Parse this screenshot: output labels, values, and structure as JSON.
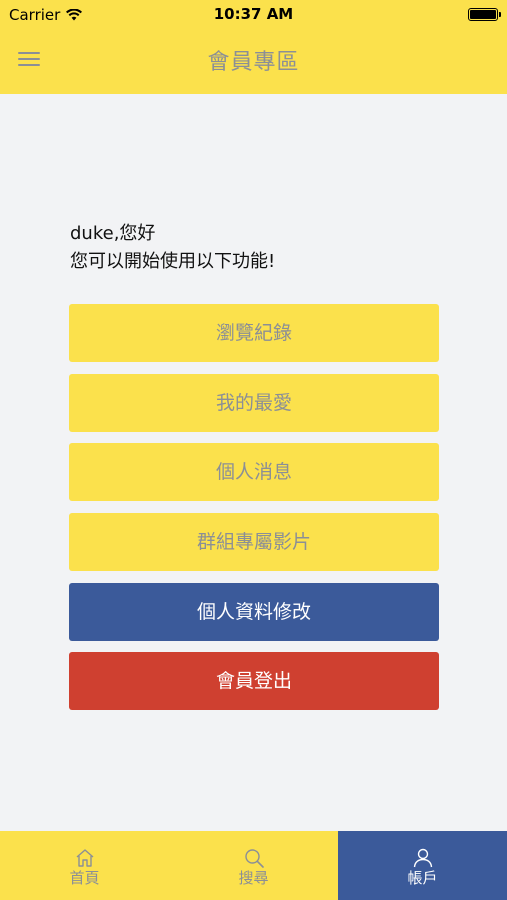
{
  "status_bar": {
    "carrier": "Carrier",
    "time": "10:37 AM"
  },
  "header": {
    "title": "會員專區"
  },
  "greeting": {
    "line1": "duke,您好",
    "line2": "您可以開始使用以下功能!"
  },
  "menu": [
    {
      "label": "瀏覽紀錄",
      "style": "yellow"
    },
    {
      "label": "我的最愛",
      "style": "yellow"
    },
    {
      "label": "個人消息",
      "style": "yellow"
    },
    {
      "label": "群組專屬影片",
      "style": "yellow"
    },
    {
      "label": "個人資料修改",
      "style": "blue"
    },
    {
      "label": "會員登出",
      "style": "red"
    }
  ],
  "tabbar": {
    "tabs": [
      {
        "label": "首頁",
        "icon": "home-icon",
        "active": false
      },
      {
        "label": "搜尋",
        "icon": "search-icon",
        "active": false
      },
      {
        "label": "帳戶",
        "icon": "user-icon",
        "active": true
      }
    ]
  },
  "colors": {
    "yellow": "#fbe14c",
    "blue": "#3b5a9a",
    "red": "#cf4030",
    "gray_text": "#8b8f96",
    "background": "#f2f3f5"
  }
}
